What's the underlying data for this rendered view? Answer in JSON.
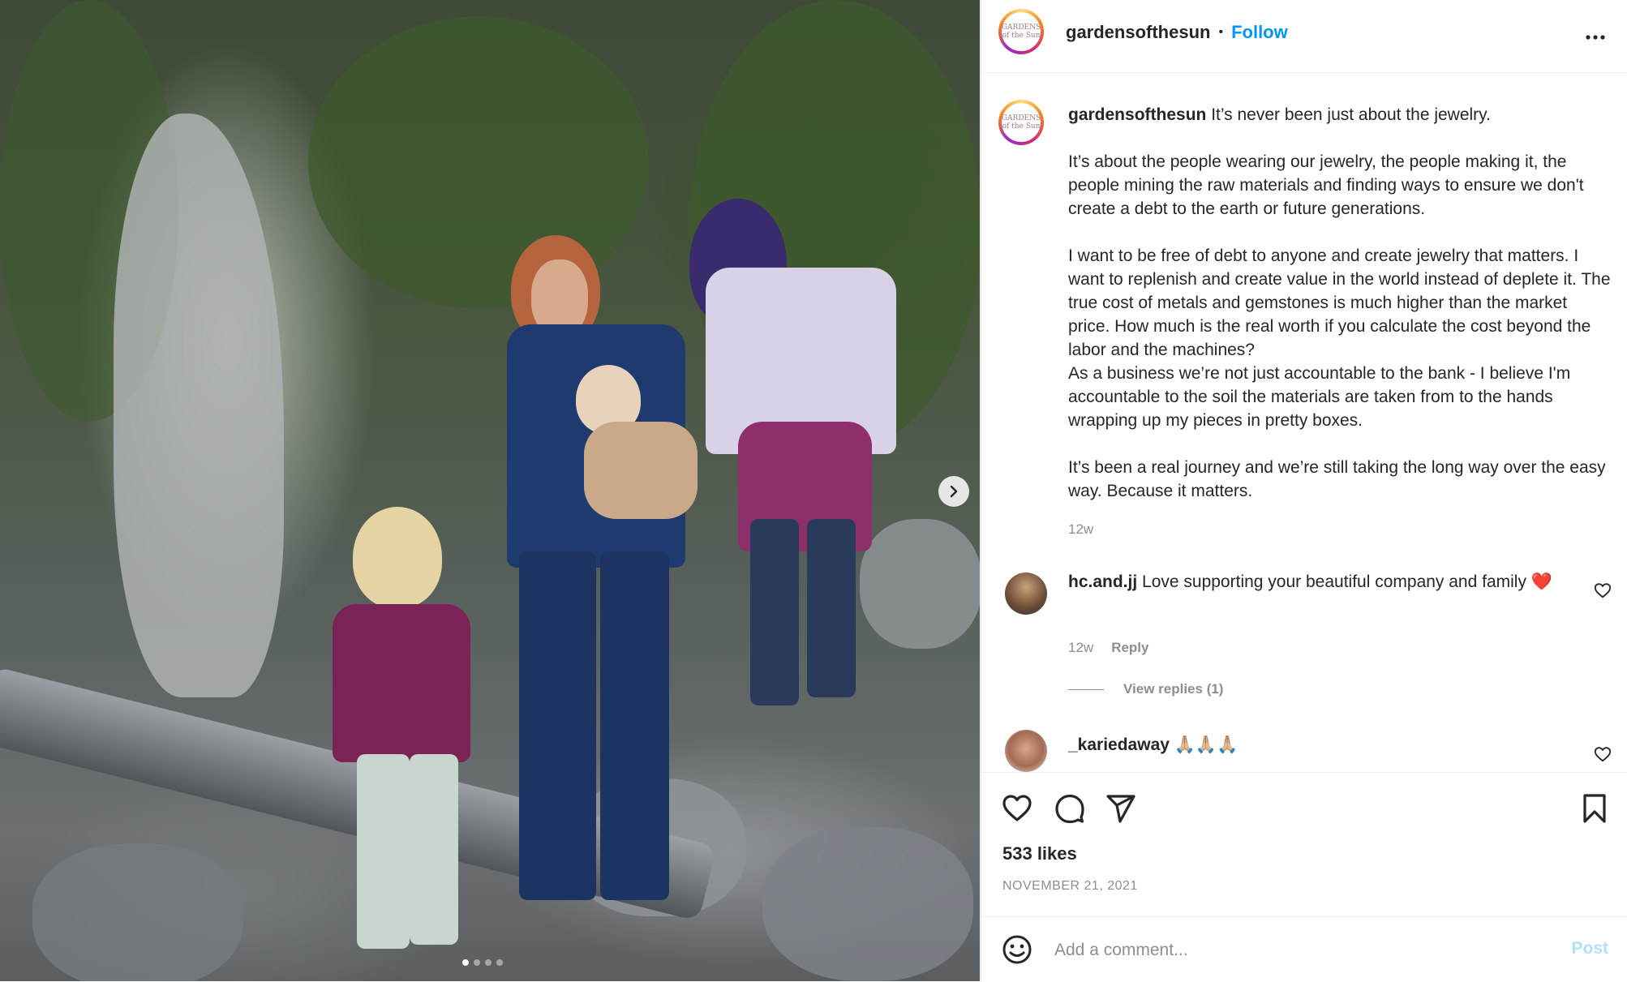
{
  "photo": {
    "alt_role": "post-photo",
    "carousel_count": 4,
    "carousel_active": 1
  },
  "header": {
    "username": "gardensofthesun",
    "separator": "•",
    "follow_label": "Follow",
    "avatar_text": "GARDENS of the Sun"
  },
  "caption": {
    "username": "gardensofthesun",
    "text": " It’s never been just about the jewelry.\n\nIt’s about the people wearing our jewelry, the people making it, the people mining the raw materials and finding ways to ensure we don't create a debt to the earth or future generations.\n\nI want to be free of debt to anyone and create jewelry that matters. I want to replenish and create value in the world instead of deplete it. The true cost of metals and gemstones is much higher than the market price. How much is the real worth if you calculate the cost beyond the labor and the machines?\nAs a business we’re not just accountable to the bank - I believe I'm accountable to the soil the materials are taken from to the hands wrapping up my pieces in pretty boxes.\n\nIt’s been a real journey and we’re still taking the long way over the easy way. Because it matters.",
    "time": "12w"
  },
  "comments": [
    {
      "username": "hc.and.jj",
      "text": " Love supporting your beautiful company and family ❤️",
      "time": "12w",
      "reply_label": "Reply",
      "view_replies": "View replies (1)"
    },
    {
      "username": "_kariedaway",
      "text": " 🙏🏼🙏🏼🙏🏼"
    }
  ],
  "actions": {
    "likes": "533 likes",
    "date": "NOVEMBER 21, 2021"
  },
  "add_comment": {
    "placeholder": "Add a comment...",
    "post_label": "Post"
  },
  "colors": {
    "link_blue": "#0095f6",
    "muted": "#8e8e8e",
    "post_disabled": "#b2dffc",
    "text": "#262626"
  },
  "icons": [
    "chevron-right-icon",
    "more-icon",
    "heart-icon",
    "comment-icon",
    "share-icon",
    "bookmark-icon",
    "emoji-icon"
  ]
}
